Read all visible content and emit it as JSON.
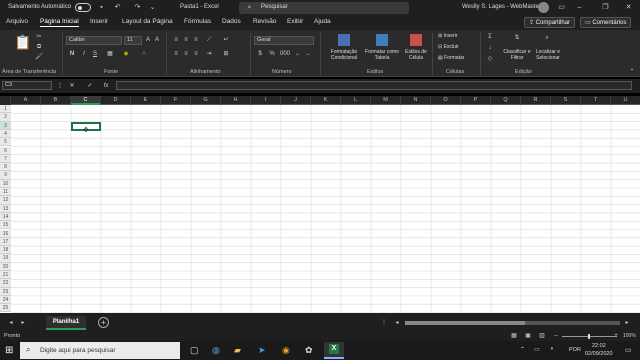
{
  "titlebar": {
    "autosave": "Salvamento Automático",
    "doc_title": "Pasta1 - Excel",
    "search_placeholder": "Pesquisar",
    "user": "Weslly S. Lages - WebMaster"
  },
  "menu": {
    "tabs": [
      "Arquivo",
      "Página Inicial",
      "Inserir",
      "Layout da Página",
      "Fórmulas",
      "Dados",
      "Revisão",
      "Exibir",
      "Ajuda"
    ],
    "share": "Compartilhar",
    "comments": "Comentários"
  },
  "ribbon": {
    "groups": [
      "Área de Transferência",
      "Fonte",
      "Alinhamento",
      "Número",
      "Estilos",
      "Células",
      "Edição"
    ],
    "font_name": "Calibri",
    "font_size": "11",
    "number_format": "Geral",
    "estilos": [
      "Formatação Condicional",
      "Formatar como Tabela",
      "Estilos de Célula"
    ],
    "celulas": [
      "Inserir",
      "Excluir",
      "Formatar"
    ],
    "edicao": [
      "Classificar e Filtrar",
      "Localizar e Selecionar"
    ]
  },
  "formula": {
    "name_box": "C3",
    "fx": "fx"
  },
  "grid": {
    "columns": [
      "A",
      "B",
      "C",
      "D",
      "E",
      "F",
      "G",
      "H",
      "I",
      "J",
      "K",
      "L",
      "M",
      "N",
      "O",
      "P",
      "Q",
      "R",
      "S",
      "T",
      "U"
    ],
    "rows": [
      "1",
      "2",
      "3",
      "4",
      "5",
      "6",
      "7",
      "8",
      "9",
      "10",
      "11",
      "12",
      "13",
      "14",
      "15",
      "16",
      "17",
      "18",
      "19",
      "20",
      "21",
      "22",
      "23",
      "24",
      "25"
    ],
    "selected_col": "C",
    "selected_row": "3"
  },
  "sheet": {
    "tab": "Planilha1",
    "add": "+"
  },
  "status": {
    "ready": "Pronto",
    "zoom": "100%"
  },
  "taskbar": {
    "search": "Digite aqui para pesquisar",
    "lang": "POR",
    "time": "22:02",
    "date": "02/09/2020"
  }
}
